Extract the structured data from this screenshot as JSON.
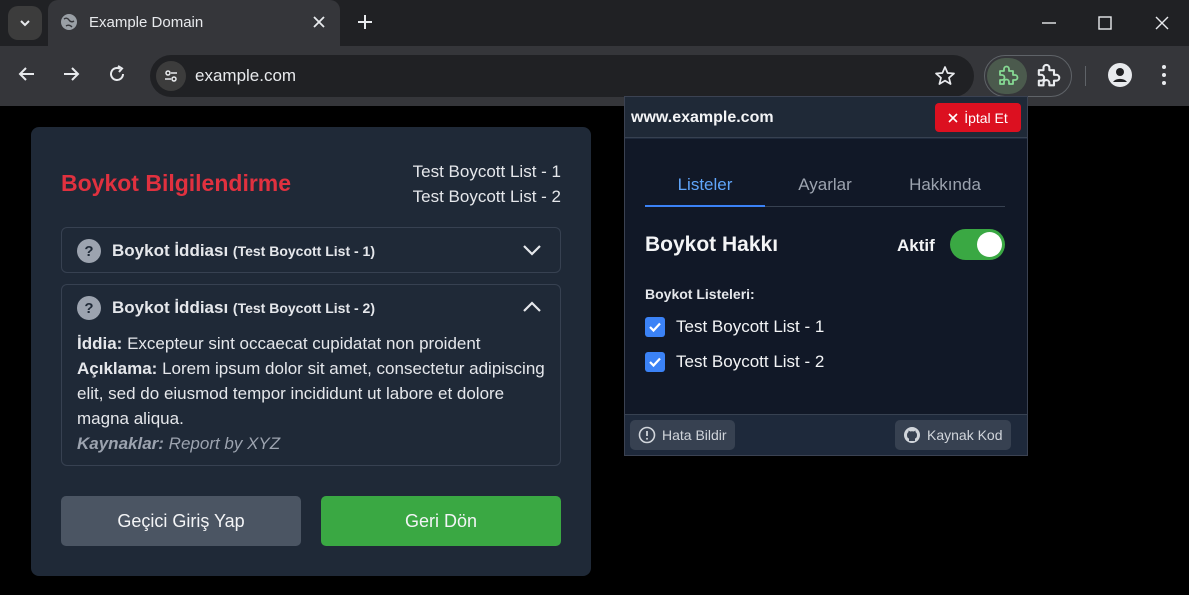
{
  "browser": {
    "tab_title": "Example Domain",
    "url": "example.com"
  },
  "card": {
    "title": "Boykot Bilgilendirme",
    "lists": [
      "Test Boycott List - 1",
      "Test Boycott List - 2"
    ],
    "accordions": [
      {
        "title": "Boykot İddiası",
        "source_list": "(Test Boycott List - 1)",
        "expanded": false
      },
      {
        "title": "Boykot İddiası",
        "source_list": "(Test Boycott List - 2)",
        "expanded": true,
        "claim_label": "İddia:",
        "claim_text": "Excepteur sint occaecat cupidatat non proident",
        "description_label": "Açıklama:",
        "description_text": "Lorem ipsum dolor sit amet, consectetur adipiscing elit, sed do eiusmod tempor incididunt ut labore et dolore magna aliqua.",
        "sources_label": "Kaynaklar:",
        "sources_text": "Report by XYZ"
      }
    ],
    "temp_login_label": "Geçici Giriş Yap",
    "go_back_label": "Geri Dön"
  },
  "popup": {
    "domain": "www.example.com",
    "cancel_label": "İptal Et",
    "tabs": [
      "Listeler",
      "Ayarlar",
      "Hakkında"
    ],
    "active_tab": "Listeler",
    "section_title": "Boykot Hakkı",
    "toggle_label": "Aktif",
    "toggle_on": true,
    "lists_label": "Boykot Listeleri:",
    "lists": [
      {
        "label": "Test Boycott List - 1",
        "checked": true
      },
      {
        "label": "Test Boycott List - 2",
        "checked": true
      }
    ],
    "report_label": "Hata Bildir",
    "source_label": "Kaynak Kod"
  },
  "colors": {
    "accent_red": "#e0313f",
    "green": "#3aa843",
    "blue": "#3b82f6"
  }
}
